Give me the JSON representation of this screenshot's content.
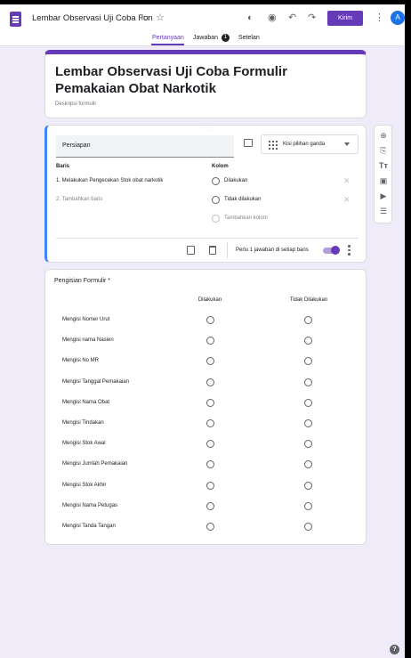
{
  "app": {
    "doc_title": "Lembar Observasi Uji Coba Fon",
    "send_label": "Kirim",
    "avatar_letter": "A"
  },
  "tabs": [
    {
      "label": "Pertanyaan"
    },
    {
      "label": "Jawaban"
    },
    {
      "label": "Setelan"
    }
  ],
  "responses_count": "1",
  "form": {
    "title": "Lembar Observasi Uji Coba Formulir Pemakaian Obat Narkotik",
    "description": "Deskripsi formulir"
  },
  "question": {
    "title_value": "Persiapan",
    "type_label": "Kisi pilihan ganda",
    "rows_header": "Baris",
    "cols_header": "Kolom",
    "rows": [
      "1.  Melakukan Pengecekan Stok obat narkotik"
    ],
    "add_row": "2.  Tambahkan baris",
    "columns": [
      "Dilakukan",
      "Tidak dilakukan"
    ],
    "add_column": "Tambahkan kolom",
    "require_label": "Perlu 1 jawaban di setiap baris",
    "require_on": true
  },
  "preview": {
    "title": "Pengisian Formulir *",
    "columns": [
      "Dilakukan",
      "Tidak Dilakukan"
    ],
    "rows": [
      "Mengisi Nomer Urut",
      "Mengisi nama Nasien",
      "Mengisi No MR",
      "Mengisi Tanggal Pemakaian",
      "Mengisi Nama Obat",
      "Mengisi Tindakan",
      "Mengisi Stok Awal",
      "Mengisi Jumlah Pemakaian",
      "Mengisi Stok Akhir",
      "Mengisi Nama Petugas",
      "Mengisi Tanda Tangan"
    ]
  },
  "colors": {
    "accent": "#673ab7",
    "active_border": "#4285f4",
    "background": "#f0ebf8"
  }
}
